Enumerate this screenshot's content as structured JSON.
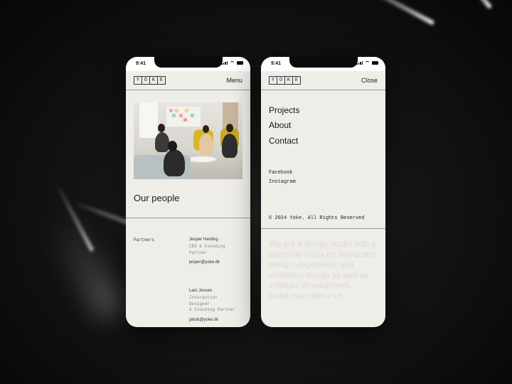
{
  "left_phone": {
    "status_time": "9:41",
    "logo_letters": [
      "Y",
      "O",
      "K",
      "E"
    ],
    "menu_label": "Menu",
    "section_title": "Our people",
    "partners_label": "Partners",
    "people": [
      {
        "name": "Jesper Harding",
        "role": "CEO & Founding Partner",
        "role_lines": [
          "CEO & Founding",
          "Partner"
        ],
        "email": "jesper@yoke.dk"
      },
      {
        "name": "Lars Jessen",
        "role": "Interaction Designer & Founding Partner",
        "role_lines": [
          "Interaction",
          "Designer",
          "& Founding Partner"
        ],
        "email": "jakob@yoke.dk"
      }
    ]
  },
  "right_phone": {
    "status_time": "9:41",
    "logo_letters": [
      "Y",
      "O",
      "K",
      "E"
    ],
    "close_label": "Close",
    "nav": [
      "Projects",
      "About",
      "Contact"
    ],
    "social": [
      "Facebook",
      "Instagram"
    ],
    "copyright": "© 2024 Yoke. All Rights Reserved",
    "blurb": "We are a design studio with a particular focus on interaction design, experience and exhibition design as well as software development.",
    "read_more": "Read more about us"
  },
  "colors": {
    "background": "#0b0b0b",
    "phone_surface": "#efede7",
    "text": "#1b1b1b",
    "muted": "#8a8780",
    "faded": "#dcdad3"
  },
  "icons": [
    "cellular-signal-icon",
    "wifi-icon",
    "battery-icon"
  ]
}
